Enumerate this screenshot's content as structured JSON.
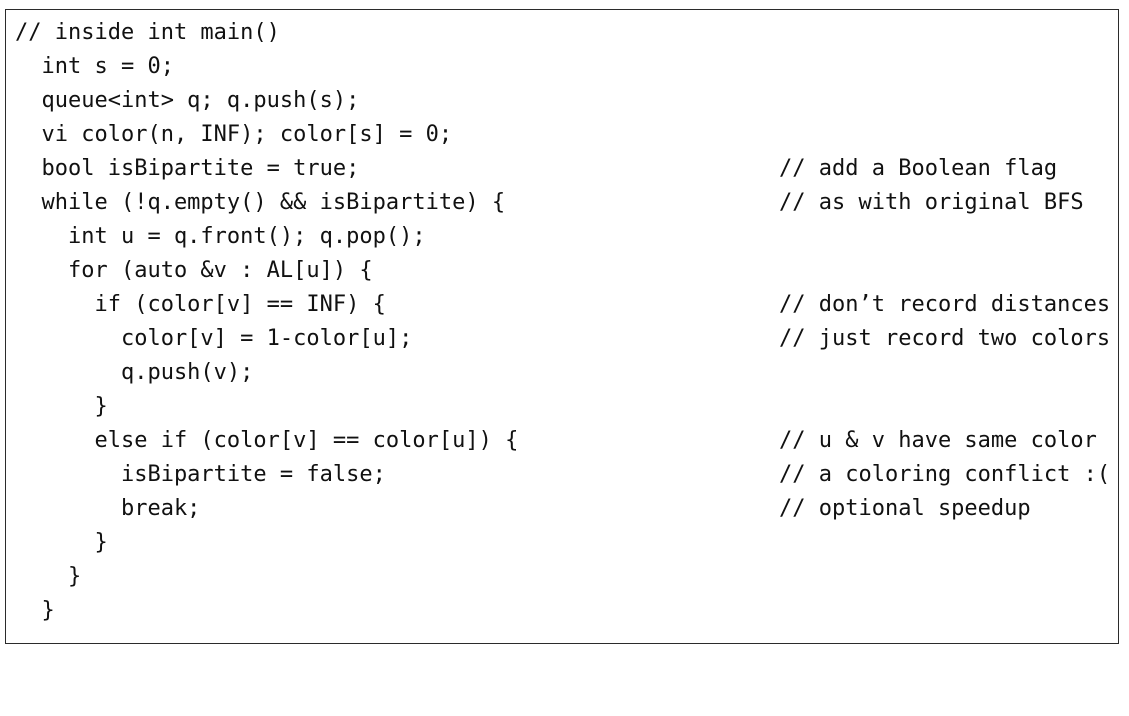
{
  "code_listing": {
    "lines": [
      {
        "code": "// inside int main()",
        "comment": ""
      },
      {
        "code": "  int s = 0;",
        "comment": ""
      },
      {
        "code": "  queue<int> q; q.push(s);",
        "comment": ""
      },
      {
        "code": "  vi color(n, INF); color[s] = 0;",
        "comment": ""
      },
      {
        "code": "  bool isBipartite = true;",
        "comment": "// add a Boolean flag"
      },
      {
        "code": "  while (!q.empty() && isBipartite) {",
        "comment": "// as with original BFS"
      },
      {
        "code": "    int u = q.front(); q.pop();",
        "comment": ""
      },
      {
        "code": "    for (auto &v : AL[u]) {",
        "comment": ""
      },
      {
        "code": "      if (color[v] == INF) {",
        "comment": "// don’t record distances"
      },
      {
        "code": "        color[v] = 1-color[u];",
        "comment": "// just record two colors"
      },
      {
        "code": "        q.push(v);",
        "comment": ""
      },
      {
        "code": "      }",
        "comment": ""
      },
      {
        "code": "      else if (color[v] == color[u]) {",
        "comment": "// u & v have same color"
      },
      {
        "code": "        isBipartite = false;",
        "comment": "// a coloring conflict :("
      },
      {
        "code": "        break;",
        "comment": "// optional speedup"
      },
      {
        "code": "      }",
        "comment": ""
      },
      {
        "code": "    }",
        "comment": ""
      },
      {
        "code": "  }",
        "comment": ""
      }
    ]
  }
}
